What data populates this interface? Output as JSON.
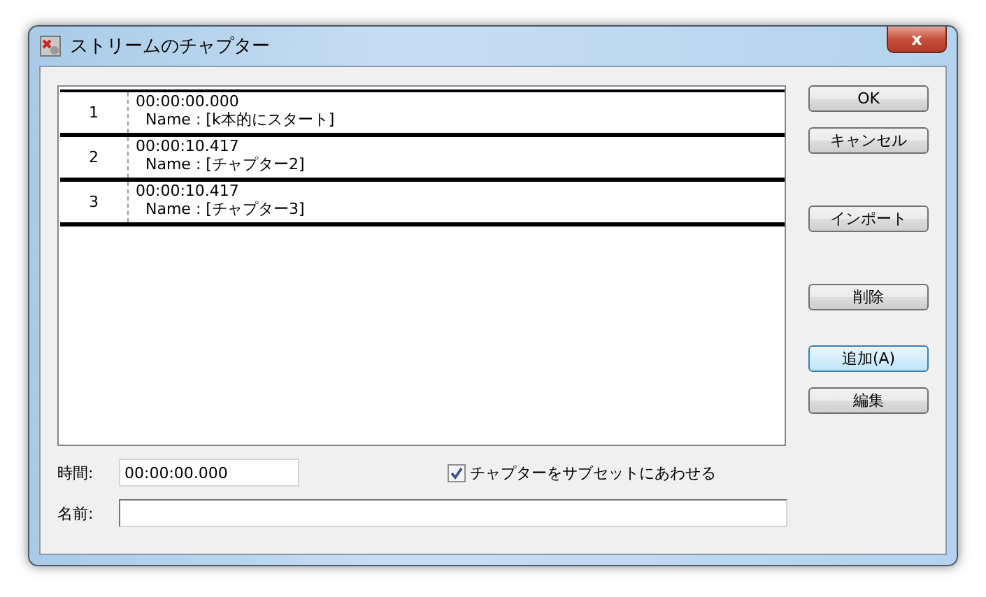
{
  "window": {
    "title": "ストリームのチャプター",
    "close": "x"
  },
  "chapters": [
    {
      "number": "1",
      "time": "00:00:00.000",
      "name": "Name : [k本的にスタート]"
    },
    {
      "number": "2",
      "time": "00:00:10.417",
      "name": "Name : [チャプター2]"
    },
    {
      "number": "3",
      "time": "00:00:10.417",
      "name": "Name : [チャプター3]"
    }
  ],
  "buttons": [
    {
      "label": "OK",
      "focused": false
    },
    {
      "label": "キャンセル",
      "focused": false
    },
    {
      "label": "インポート",
      "focused": false
    },
    {
      "label": "削除",
      "focused": false
    },
    {
      "label": "追加(A)",
      "focused": true
    },
    {
      "label": "編集",
      "focused": false
    }
  ],
  "time_field": {
    "label": "時間:",
    "value": "00:00:00.000"
  },
  "subset_checkbox": {
    "label": "チャプターをサブセットにあわせる",
    "checked": true
  },
  "name_field": {
    "label": "名前:"
  }
}
